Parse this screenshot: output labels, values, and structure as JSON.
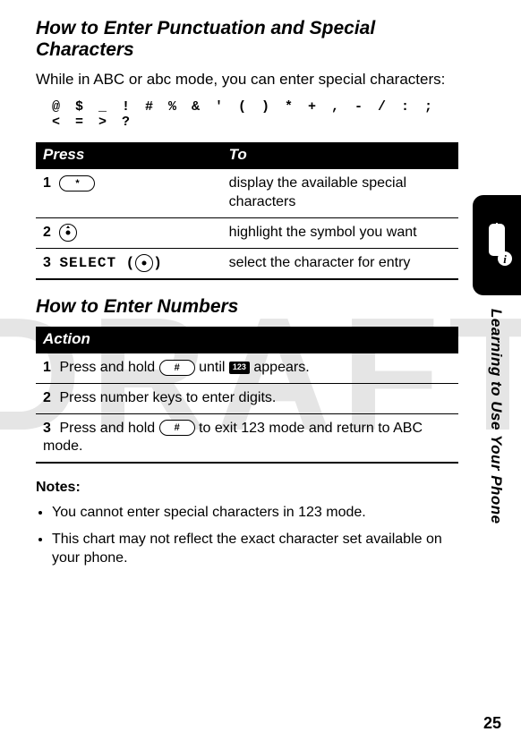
{
  "watermark": "DRAFT",
  "section1": {
    "title": "How to Enter Punctuation and Special Characters",
    "intro": "While in ABC or abc mode, you can enter special characters:",
    "symbols": "@ $ _ ! # % & ' ( ) * + , - / : ; < = > ?"
  },
  "table1": {
    "head_press": "Press",
    "head_to": "To",
    "rows": [
      {
        "n": "1",
        "press_kind": "key",
        "press_text": "*",
        "to": "display the available special characters"
      },
      {
        "n": "2",
        "press_kind": "joy-nav",
        "press_text": "",
        "to": "highlight the symbol you want"
      },
      {
        "n": "3",
        "press_kind": "label-joy",
        "press_text": "SELECT (",
        "press_suffix": ")",
        "to": "select the character for entry"
      }
    ]
  },
  "section2": {
    "title": "How to Enter Numbers"
  },
  "table2": {
    "head_action": "Action",
    "rows": [
      {
        "n": "1",
        "pre": "Press and hold ",
        "key": "#",
        "mid": " until ",
        "badge": "123",
        "post": " appears."
      },
      {
        "n": "2",
        "text": "Press number keys to enter digits."
      },
      {
        "n": "3",
        "pre": "Press and hold ",
        "key": "#",
        "post": " to exit 123 mode and return to ABC mode."
      }
    ]
  },
  "notes": {
    "head": "Notes:",
    "items": [
      "You cannot enter special characters in 123 mode.",
      "This chart may not reflect the exact character set available on your phone."
    ]
  },
  "side_text": "Learning to Use Your Phone",
  "page_num": "25"
}
